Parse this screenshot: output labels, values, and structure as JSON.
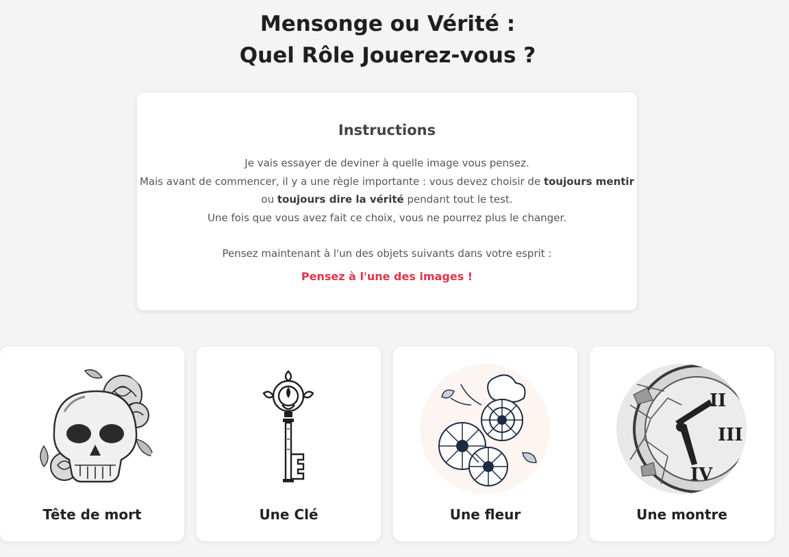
{
  "header": {
    "title_line1": "Mensonge ou Vérité :",
    "title_line2": "Quel Rôle Jouerez-vous ?"
  },
  "instructions": {
    "heading": "Instructions",
    "line1": "Je vais essayer de deviner à quelle image vous pensez.",
    "line2_before": "Mais avant de commencer, il y a une règle importante : vous devez choisir de ",
    "line2_bold": "toujours mentir",
    "line3_before": "ou ",
    "line3_bold": "toujours dire la vérité",
    "line3_after": " pendant tout le test.",
    "line4": "Une fois que vous avez fait ce choix, vous ne pourrez plus le changer.",
    "line5": "Pensez maintenant à l'un des objets suivants dans votre esprit :",
    "hint": "Pensez à l'une des images !",
    "hint_color": "#e0344a"
  },
  "choices": [
    {
      "label": "Tête de mort",
      "icon": "skull-icon"
    },
    {
      "label": "Une Clé",
      "icon": "key-icon"
    },
    {
      "label": "Une fleur",
      "icon": "flower-icon"
    },
    {
      "label": "Une montre",
      "icon": "clock-icon"
    }
  ]
}
